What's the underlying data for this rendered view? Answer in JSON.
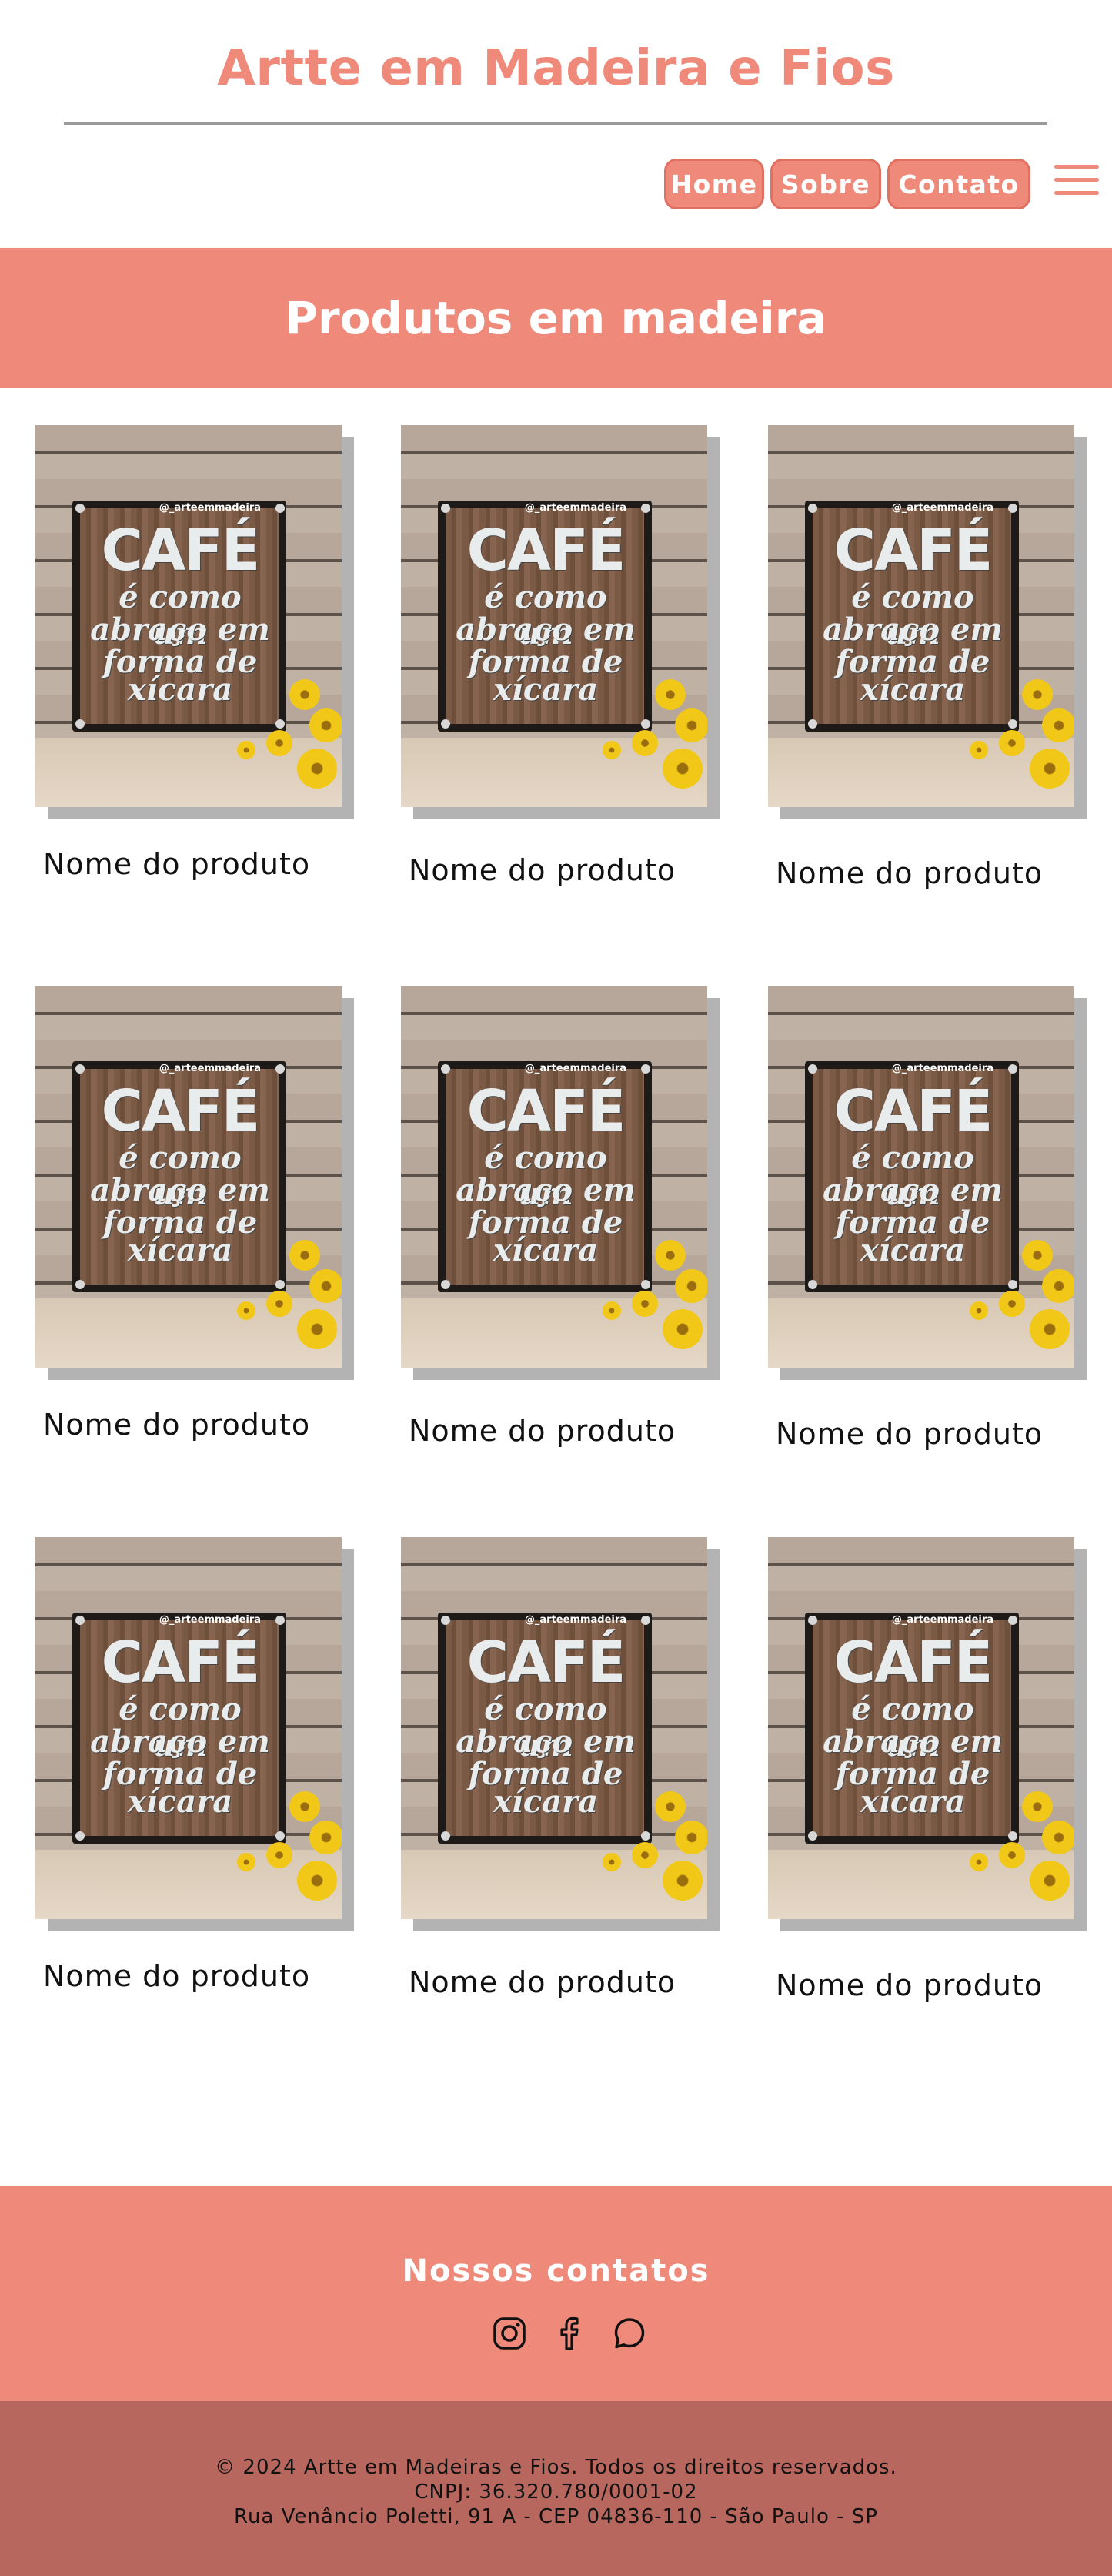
{
  "header": {
    "title": "Artte em Madeira e Fios",
    "nav": [
      {
        "label": "Home"
      },
      {
        "label": "Sobre"
      },
      {
        "label": "Contato"
      }
    ],
    "menu_icon": "hamburger-menu-icon"
  },
  "banner": {
    "title": "Produtos em madeira"
  },
  "products": [
    {
      "name": "Nome do produto",
      "image": {
        "watermark": "@_arteemmadeira",
        "line1": "CAFÉ",
        "line2": "é como um",
        "line3": "abraço em",
        "line4": "forma de",
        "line5": "xícara"
      }
    },
    {
      "name": "Nome do produto",
      "image": {
        "watermark": "@_arteemmadeira",
        "line1": "CAFÉ",
        "line2": "é como um",
        "line3": "abraço em",
        "line4": "forma de",
        "line5": "xícara"
      }
    },
    {
      "name": "Nome do produto",
      "image": {
        "watermark": "@_arteemmadeira",
        "line1": "CAFÉ",
        "line2": "é como um",
        "line3": "abraço em",
        "line4": "forma de",
        "line5": "xícara"
      }
    },
    {
      "name": "Nome do produto",
      "image": {
        "watermark": "@_arteemmadeira",
        "line1": "CAFÉ",
        "line2": "é como um",
        "line3": "abraço em",
        "line4": "forma de",
        "line5": "xícara"
      }
    },
    {
      "name": "Nome do produto",
      "image": {
        "watermark": "@_arteemmadeira",
        "line1": "CAFÉ",
        "line2": "é como um",
        "line3": "abraço em",
        "line4": "forma de",
        "line5": "xícara"
      }
    },
    {
      "name": "Nome do produto",
      "image": {
        "watermark": "@_arteemmadeira",
        "line1": "CAFÉ",
        "line2": "é como um",
        "line3": "abraço em",
        "line4": "forma de",
        "line5": "xícara"
      }
    },
    {
      "name": "Nome do produto",
      "image": {
        "watermark": "@_arteemmadeira",
        "line1": "CAFÉ",
        "line2": "é como um",
        "line3": "abraço em",
        "line4": "forma de",
        "line5": "xícara"
      }
    },
    {
      "name": "Nome do produto",
      "image": {
        "watermark": "@_arteemmadeira",
        "line1": "CAFÉ",
        "line2": "é como um",
        "line3": "abraço em",
        "line4": "forma de",
        "line5": "xícara"
      }
    },
    {
      "name": "Nome do produto",
      "image": {
        "watermark": "@_arteemmadeira",
        "line1": "CAFÉ",
        "line2": "é como um",
        "line3": "abraço em",
        "line4": "forma de",
        "line5": "xícara"
      }
    }
  ],
  "footer": {
    "title": "Nossos contatos",
    "socials": [
      {
        "icon": "instagram-icon"
      },
      {
        "icon": "facebook-icon"
      },
      {
        "icon": "whatsapp-icon"
      }
    ],
    "copyright": "© 2024 Artte em Madeiras e Fios. Todos os direitos reservados.",
    "cnpj": "CNPJ: 36.320.780/0001-02",
    "address": "Rua Venâncio Poletti, 91 A - CEP 04836-110 - São Paulo - SP"
  },
  "colors": {
    "accent": "#ef8a7b",
    "footer_bottom": "#b8675e",
    "shadow": "#b3b3b3"
  }
}
